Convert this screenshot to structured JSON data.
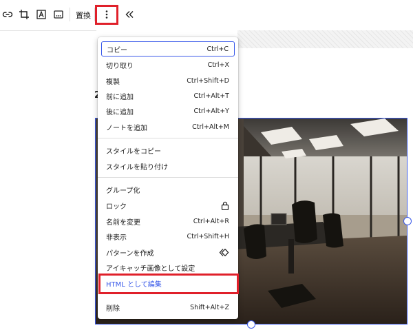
{
  "toolbar": {
    "link_icon": "link-icon",
    "crop_icon": "crop-icon",
    "text_overlay_icon": "text-overlay-icon",
    "alt_text_icon": "alt-text-icon",
    "replace_label": "置換",
    "options_icon": "more-vertical-icon",
    "collapse_icon": "chevrons-left-icon"
  },
  "stray_text": "2",
  "menu": {
    "groups": [
      [
        {
          "label": "コピー",
          "shortcut": "Ctrl+C"
        },
        {
          "label": "切り取り",
          "shortcut": "Ctrl+X"
        },
        {
          "label": "複製",
          "shortcut": "Ctrl+Shift+D"
        },
        {
          "label": "前に追加",
          "shortcut": "Ctrl+Alt+T"
        },
        {
          "label": "後に追加",
          "shortcut": "Ctrl+Alt+Y"
        },
        {
          "label": "ノートを追加",
          "shortcut": "Ctrl+Alt+M"
        }
      ],
      [
        {
          "label": "スタイルをコピー",
          "shortcut": ""
        },
        {
          "label": "スタイルを貼り付け",
          "shortcut": ""
        }
      ],
      [
        {
          "label": "グループ化",
          "shortcut": ""
        },
        {
          "label": "ロック",
          "shortcut": "",
          "icon": "lock-icon"
        },
        {
          "label": "名前を変更",
          "shortcut": "Ctrl+Alt+R"
        },
        {
          "label": "非表示",
          "shortcut": "Ctrl+Shift+H"
        },
        {
          "label": "パターンを作成",
          "shortcut": "",
          "icon": "symbol-icon"
        },
        {
          "label": "アイキャッチ画像として設定",
          "shortcut": ""
        },
        {
          "label": "HTML として編集",
          "shortcut": ""
        }
      ],
      [
        {
          "label": "削除",
          "shortcut": "Shift+Alt+Z"
        }
      ]
    ]
  },
  "colors": {
    "accent": "#3858e9",
    "highlight": "#e0202a"
  }
}
